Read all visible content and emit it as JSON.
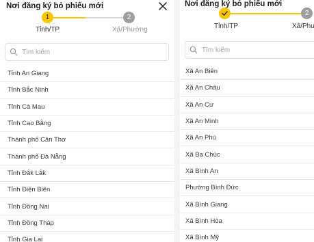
{
  "left": {
    "title": "Nơi đăng ký bỏ phiếu mới",
    "steps": [
      {
        "number": "1",
        "label": "Tỉnh/TP",
        "state": "active"
      },
      {
        "number": "2",
        "label": "Xã/Phường",
        "state": "inactive"
      }
    ],
    "search": {
      "placeholder": "Tìm kiếm"
    },
    "items": [
      "Tỉnh An Giang",
      "Tỉnh Bắc Ninh",
      "Tỉnh Cà Mau",
      "Tỉnh Cao Bằng",
      "Thành phố Cần Thơ",
      "Thành phố Đà Nẵng",
      "Tỉnh Đắk Lắk",
      "Tỉnh Điện Biên",
      "Tỉnh Đồng Nai",
      "Tỉnh Đồng Tháp",
      "Tỉnh Gia Lai"
    ]
  },
  "right": {
    "title": "Nơi đăng ký bỏ phiếu mới",
    "steps": [
      {
        "number": "1",
        "label": "Tỉnh/TP",
        "state": "done"
      },
      {
        "number": "2",
        "label": "Xã/Phường",
        "state": "inactive"
      }
    ],
    "search": {
      "placeholder": "Tìm kiếm"
    },
    "items": [
      "Xã An Biên",
      "Xã An Châu",
      "Xã An Cư",
      "Xã An Minh",
      "Xã An Phú",
      "Xã Ba Chúc",
      "Xã Bình An",
      "Phường Bình Đức",
      "Xã Bình Giang",
      "Xã Bình Hòa",
      "Xã Bình Mỹ"
    ]
  },
  "icons": {
    "close": "close-icon",
    "search": "search-icon",
    "check": "check-icon"
  },
  "colors": {
    "accent": "#f7c600",
    "inactive_step": "#9e9e9e",
    "divider": "#e9e9e9"
  }
}
